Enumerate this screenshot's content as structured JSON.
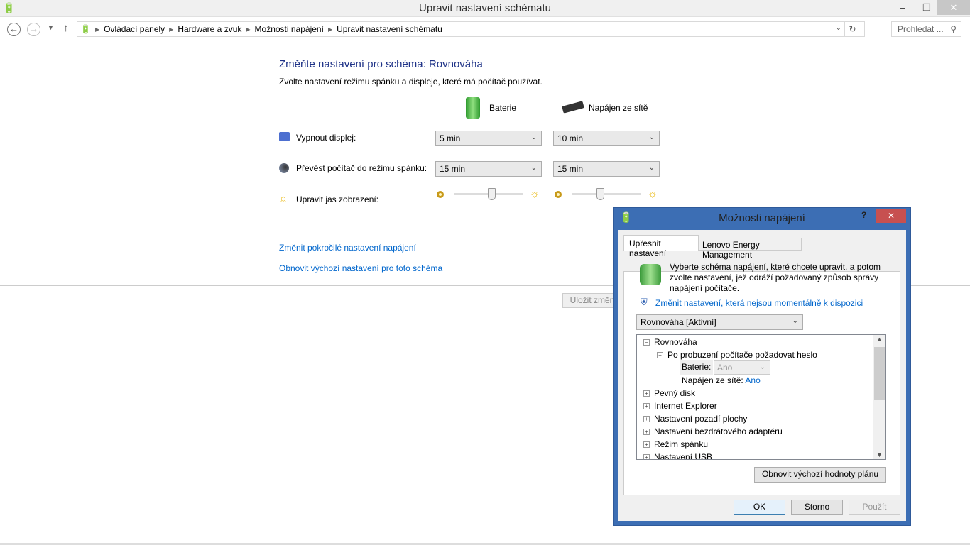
{
  "window": {
    "title": "Upravit nastavení schématu",
    "minimize": "–",
    "restore": "❐",
    "close": "✕"
  },
  "address": {
    "crumbs": [
      "Ovládací panely",
      "Hardware a zvuk",
      "Možnosti napájení",
      "Upravit nastavení schématu"
    ],
    "search_placeholder": "Prohledat ..."
  },
  "main": {
    "heading": "Změňte nastavení pro schéma: Rovnováha",
    "subtitle": "Zvolte nastavení režimu spánku a displeje, které má počítač používat.",
    "col_battery": "Baterie",
    "col_ac": "Napájen ze sítě",
    "rows": [
      {
        "label": "Vypnout displej:",
        "battery": "5 min",
        "ac": "10 min"
      },
      {
        "label": "Převést počítač do režimu spánku:",
        "battery": "15 min",
        "ac": "15 min"
      }
    ],
    "brightness_label": "Upravit jas zobrazení:",
    "brightness_battery": 0.55,
    "brightness_ac": 0.4,
    "link_advanced": "Změnit pokročilé nastavení napájení",
    "link_restore": "Obnovit výchozí nastavení pro toto schéma",
    "save": "Uložit změny"
  },
  "dialog": {
    "title": "Možnosti napájení",
    "help": "?",
    "close": "✕",
    "tabs": [
      "Upřesnit nastavení",
      "Lenovo Energy Management"
    ],
    "description": "Vyberte schéma napájení, které chcete upravit, a potom zvolte nastavení, jež odráží požadovaný způsob správy napájení počítače.",
    "admin_link": "Změnit nastavení, která nejsou momentálně k dispozici",
    "scheme": "Rovnováha [Aktivní]",
    "tree": {
      "root": "Rovnováha",
      "child": "Po probuzení počítače požadovat heslo",
      "battery_label": "Baterie:",
      "battery_value": "Ano",
      "ac_label": "Napájen ze sítě:",
      "ac_value": "Ano",
      "items": [
        "Pevný disk",
        "Internet Explorer",
        "Nastavení pozadí plochy",
        "Nastavení bezdrátového adaptéru",
        "Režim spánku",
        "Nastavení USB"
      ]
    },
    "restore_button": "Obnovit výchozí hodnoty plánu",
    "ok": "OK",
    "cancel": "Storno",
    "apply": "Použít"
  }
}
